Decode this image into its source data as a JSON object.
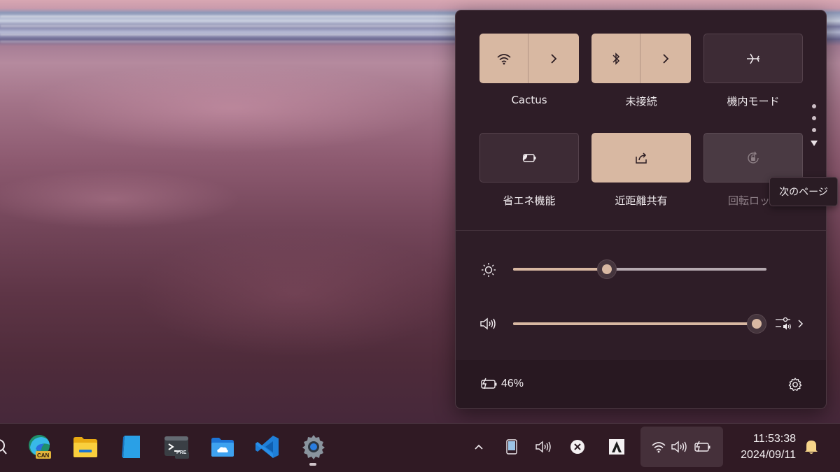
{
  "quick_settings": {
    "tiles": [
      {
        "label": "Cactus",
        "icon": "wifi-icon",
        "state": "on",
        "has_chevron": true
      },
      {
        "label": "未接続",
        "icon": "bluetooth-icon",
        "state": "on",
        "has_chevron": true
      },
      {
        "label": "機内モード",
        "icon": "airplane-icon",
        "state": "off"
      },
      {
        "label": "省エネ機能",
        "icon": "energy-saver-icon",
        "state": "off"
      },
      {
        "label": "近距離共有",
        "icon": "nearby-share-icon",
        "state": "on"
      },
      {
        "label": "回転ロッ",
        "icon": "rotation-lock-icon",
        "state": "disabled"
      }
    ],
    "tooltip": "次のページ",
    "brightness": {
      "icon": "brightness-icon",
      "value_percent": 37
    },
    "volume": {
      "icon": "speaker-icon",
      "value_percent": 100,
      "mixer_icon": "audio-mixer-icon"
    },
    "battery": {
      "icon": "battery-charging-icon",
      "text": "46%"
    },
    "settings_icon": "gear-icon"
  },
  "taskbar": {
    "apps": [
      {
        "name": "Microsoft Edge Canary",
        "icon": "edge-canary-icon",
        "badge": "CAN"
      },
      {
        "name": "File Explorer",
        "icon": "file-explorer-icon"
      },
      {
        "name": "Notes",
        "icon": "notes-icon"
      },
      {
        "name": "Terminal Preview",
        "icon": "terminal-preview-icon",
        "badge": "PRE"
      },
      {
        "name": "OneDrive folder",
        "icon": "onedrive-folder-icon"
      },
      {
        "name": "Visual Studio Code",
        "icon": "vscode-icon"
      },
      {
        "name": "Settings",
        "icon": "settings-gear-icon",
        "active": true
      }
    ],
    "tray": {
      "chevron_icon": "chevron-up-icon",
      "time": "11:53:38",
      "date": "2024/09/11"
    }
  },
  "colors": {
    "tile_on": "#d8b8a2",
    "tile_off": "#3d2b35",
    "panel_bg": "#2e1d27",
    "taskbar_bg": "#301a24"
  }
}
